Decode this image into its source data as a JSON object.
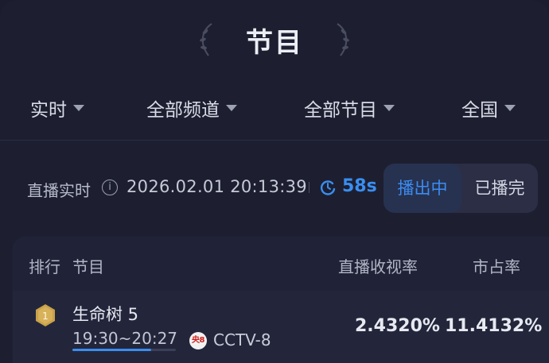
{
  "header": {
    "title": "节目"
  },
  "filters": [
    {
      "label": "实时",
      "icon": "chevron-down-icon"
    },
    {
      "label": "全部频道",
      "icon": "chevron-down-icon"
    },
    {
      "label": "全部节目",
      "icon": "chevron-down-icon"
    },
    {
      "label": "全国",
      "icon": "chevron-down-icon"
    }
  ],
  "status": {
    "label": "直播实时",
    "info_icon": "info-icon",
    "timestamp": "2026.02.01 20:13:39",
    "refresh_icon": "refresh-icon",
    "countdown": "58s",
    "toggle": {
      "active": "播出中",
      "inactive": "已播完"
    }
  },
  "table": {
    "headers": {
      "rank": "排行",
      "program": "节目",
      "rating": "直播收视率",
      "share": "市占率"
    },
    "rows": [
      {
        "rank": "1",
        "name": "生命树 5",
        "time": "19:30~20:27",
        "progress": 0.76,
        "channel_logo_text": "央8",
        "channel": "CCTV-8",
        "rating": "2.4320%",
        "share": "11.4132%"
      }
    ]
  },
  "colors": {
    "background": "#1d1f31",
    "accent": "#3a8ef0",
    "medal": "#c9a24a"
  }
}
